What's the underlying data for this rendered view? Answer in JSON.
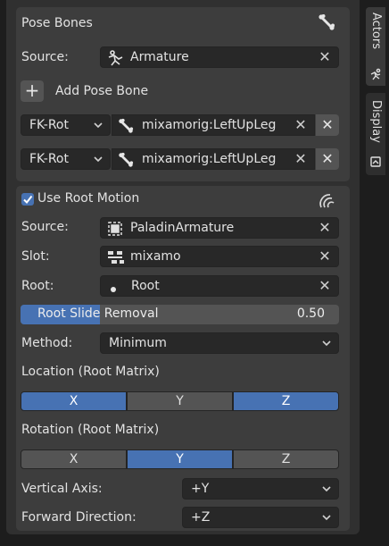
{
  "pose_bones": {
    "title": "Pose Bones",
    "source_label": "Source:",
    "source_value": "Armature",
    "add_label": "Add Pose Bone",
    "bones": [
      {
        "mode": "FK-Rot",
        "bone": "mixamorig:LeftUpLeg"
      },
      {
        "mode": "FK-Rot",
        "bone": "mixamorig:LeftUpLeg"
      }
    ]
  },
  "root_motion": {
    "checkbox_label": "Use Root Motion",
    "checked": true,
    "source_label": "Source:",
    "source_value": "PaladinArmature",
    "slot_label": "Slot:",
    "slot_value": "mixamo",
    "root_label": "Root:",
    "root_value": "Root",
    "slider_label": "Root Slide Removal",
    "slider_value": "0.50",
    "slider_fraction": 0.5,
    "method_label": "Method:",
    "method_value": "Minimum",
    "location_label": "Location (Root Matrix)",
    "location_axes": [
      {
        "label": "X",
        "on": true
      },
      {
        "label": "Y",
        "on": false
      },
      {
        "label": "Z",
        "on": true
      }
    ],
    "rotation_label": "Rotation (Root Matrix)",
    "rotation_axes": [
      {
        "label": "X",
        "on": false
      },
      {
        "label": "Y",
        "on": true
      },
      {
        "label": "Z",
        "on": false
      }
    ],
    "vertical_label": "Vertical Axis:",
    "vertical_value": "+Y",
    "forward_label": "Forward Direction:",
    "forward_value": "+Z"
  },
  "tabs": {
    "actors": "Actors",
    "display": "Display"
  },
  "colors": {
    "accent": "#4772b3",
    "panel": "#3d3d3d",
    "field": "#282828"
  }
}
